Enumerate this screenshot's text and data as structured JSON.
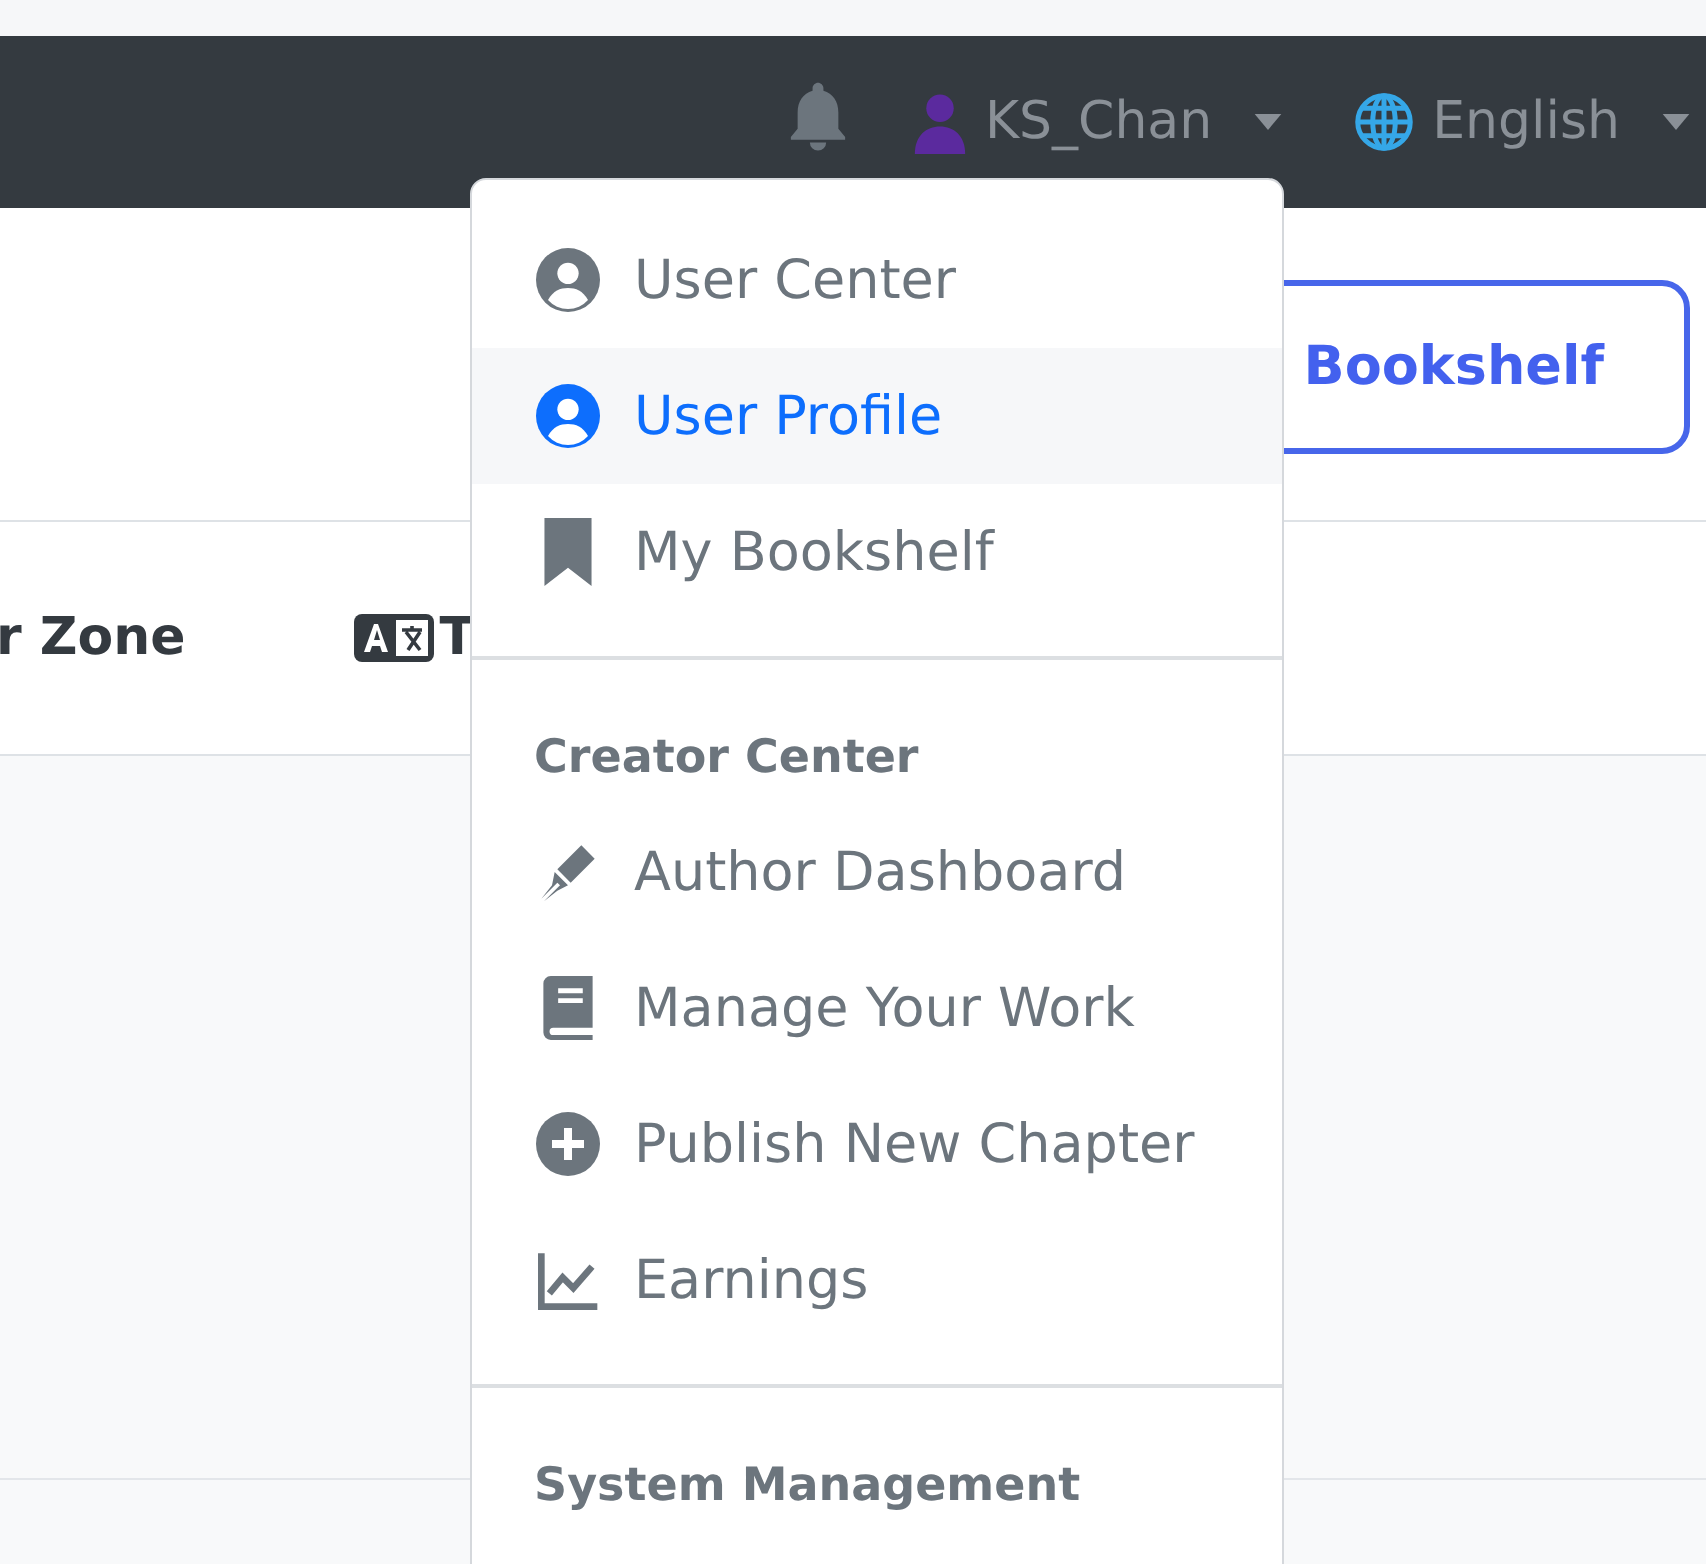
{
  "navbar": {
    "user_name": "KS_Chan",
    "language": "English"
  },
  "header": {
    "bookshelf_button": "Bookshelf"
  },
  "nav_links": [
    {
      "label": "r Zone"
    },
    {
      "label": "T"
    }
  ],
  "user_menu": [
    {
      "kind": "item",
      "label": "User Center",
      "selected": false
    },
    {
      "kind": "item",
      "label": "User Profile",
      "selected": true
    },
    {
      "kind": "item",
      "label": "My Bookshelf",
      "selected": false
    },
    {
      "kind": "divider"
    },
    {
      "kind": "header",
      "label": "Creator Center"
    },
    {
      "kind": "item",
      "label": "Author Dashboard",
      "selected": false
    },
    {
      "kind": "item",
      "label": "Manage Your Work",
      "selected": false
    },
    {
      "kind": "item",
      "label": "Publish New Chapter",
      "selected": false
    },
    {
      "kind": "item",
      "label": "Earnings",
      "selected": false
    },
    {
      "kind": "divider"
    },
    {
      "kind": "header",
      "label": "System Management"
    }
  ]
}
